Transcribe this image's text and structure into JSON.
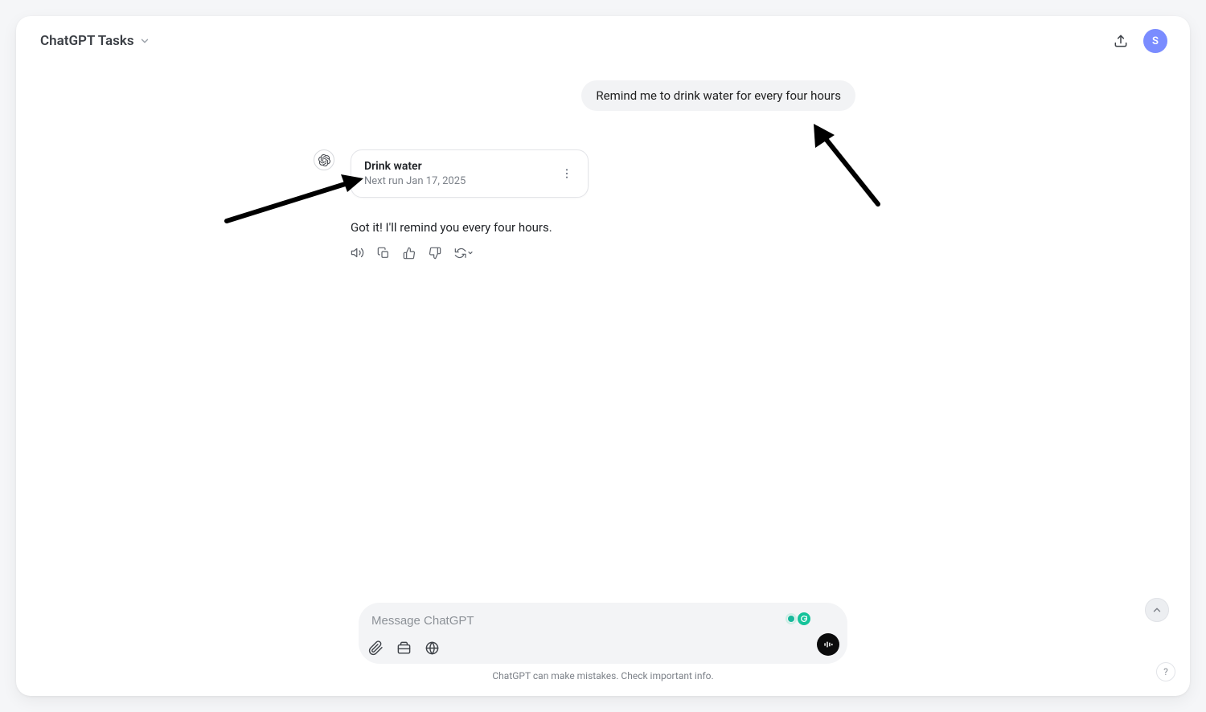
{
  "header": {
    "title": "ChatGPT Tasks",
    "avatar_letter": "S"
  },
  "conversation": {
    "user_message": "Remind me to drink water for every four hours",
    "task_card": {
      "title": "Drink water",
      "subtitle": "Next run Jan 17, 2025"
    },
    "assistant_message": "Got it! I'll remind you every four hours."
  },
  "composer": {
    "placeholder": "Message ChatGPT"
  },
  "footer": {
    "disclaimer": "ChatGPT can make mistakes. Check important info."
  },
  "help_label": "?"
}
